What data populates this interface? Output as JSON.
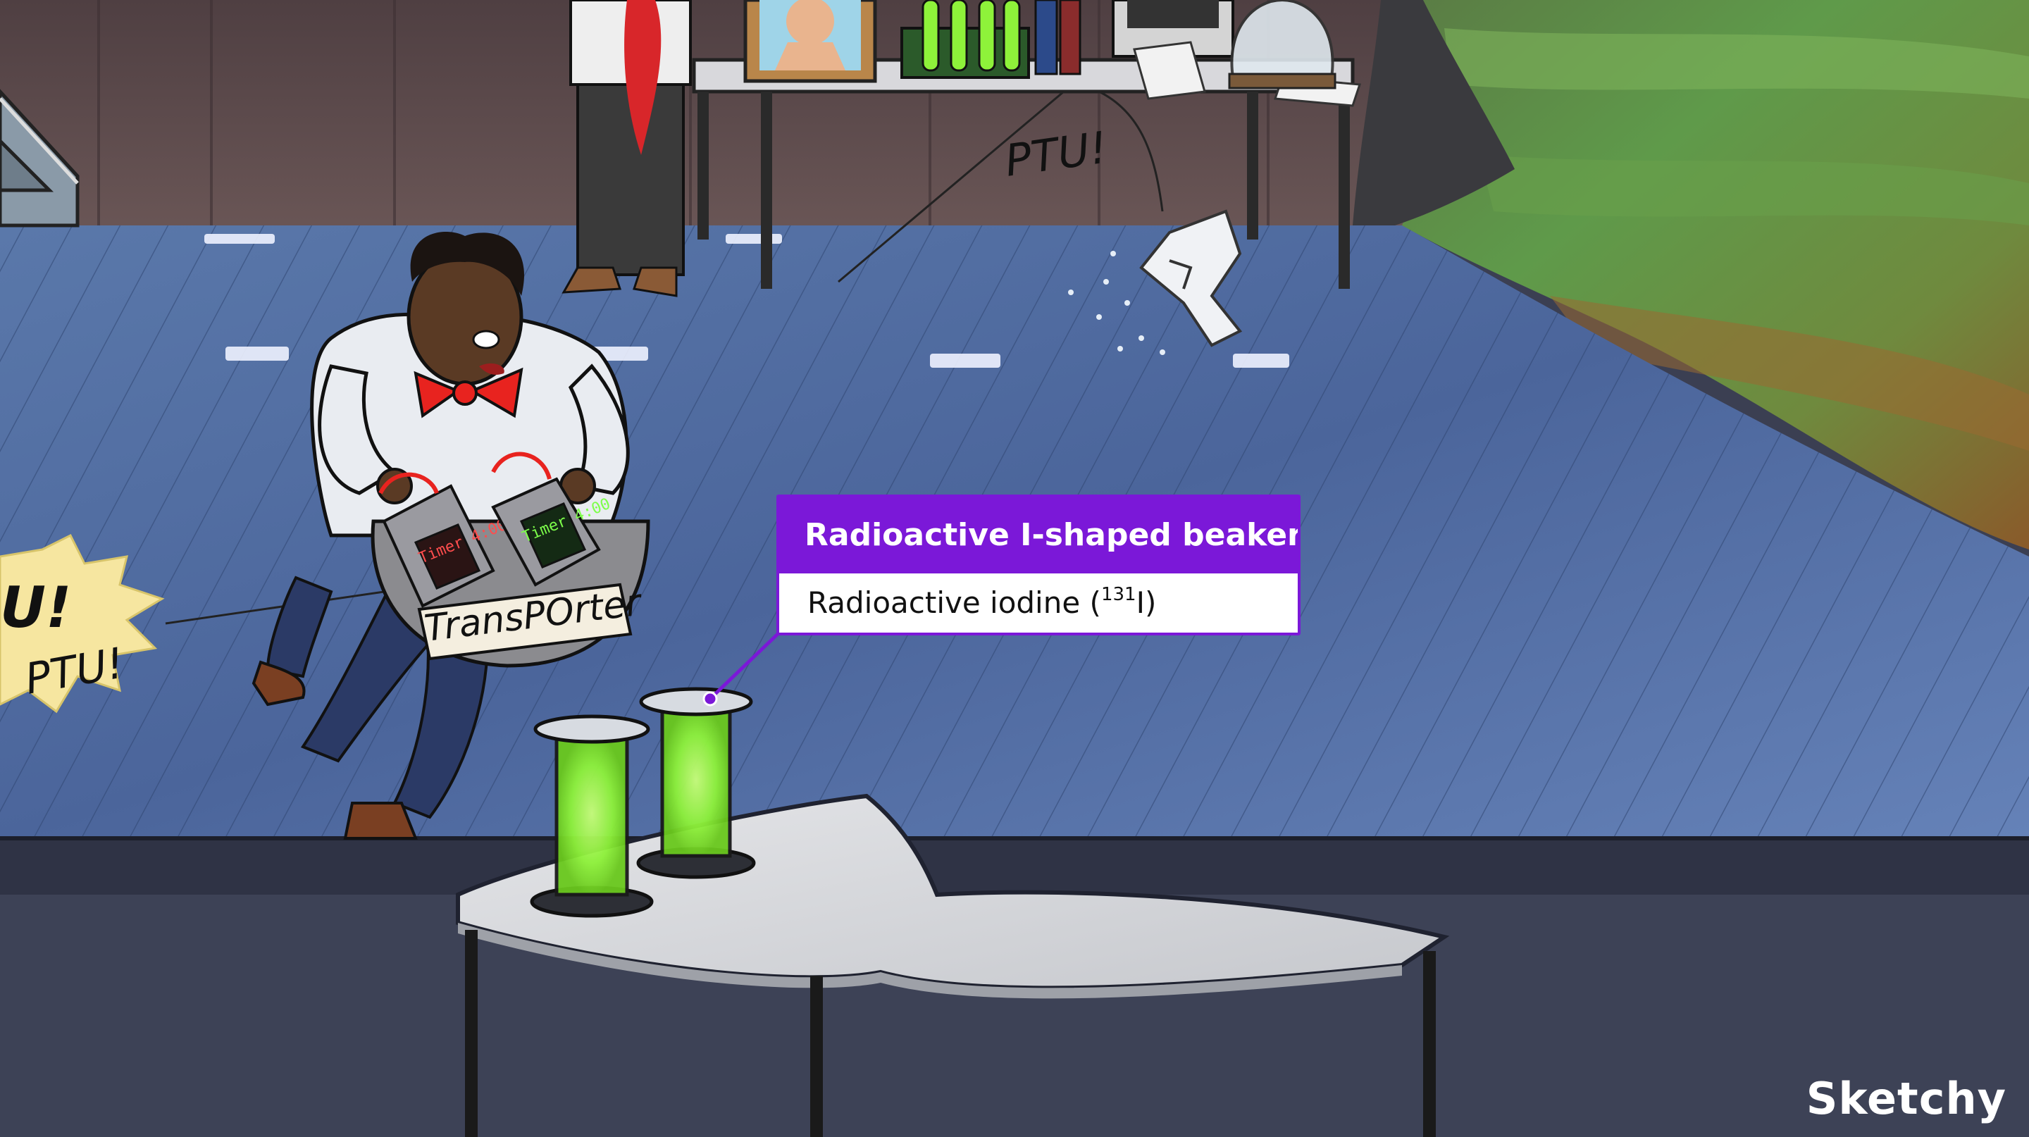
{
  "callout": {
    "title": "Radioactive I-shaped beakers",
    "body_prefix": "Radioactive iodine (",
    "body_superscript": "131",
    "body_suffix": "I)"
  },
  "scene_text": {
    "bag_label": "TransPOrter",
    "timer_left": "Timer 4:00",
    "timer_right": "Timer 4:00",
    "ptu_top": "PTU!",
    "ptu_left_a": "U!",
    "ptu_left_b": "PTU!"
  },
  "brand": "Sketchy",
  "colors": {
    "accent": "#7b18d8",
    "floor": "#4a6294",
    "wall": "#5b4a4c",
    "glow": "#8ef23a",
    "bowtie": "#e8231f"
  }
}
